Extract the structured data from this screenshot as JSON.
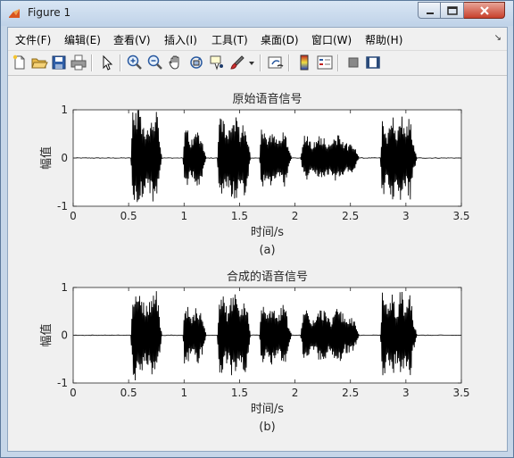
{
  "window": {
    "title": "Figure 1"
  },
  "menubar": {
    "items": [
      {
        "label": "文件(F)"
      },
      {
        "label": "编辑(E)"
      },
      {
        "label": "查看(V)"
      },
      {
        "label": "插入(I)"
      },
      {
        "label": "工具(T)"
      },
      {
        "label": "桌面(D)"
      },
      {
        "label": "窗口(W)"
      },
      {
        "label": "帮助(H)"
      }
    ],
    "overflow_icon": "dock-arrow-icon"
  },
  "toolbar": {
    "buttons": [
      "new-figure-icon",
      "open-file-icon",
      "save-icon",
      "print-icon",
      "pointer-icon",
      "zoom-in-icon",
      "zoom-out-icon",
      "pan-hand-icon",
      "rotate-3d-icon",
      "data-cursor-icon",
      "brush-icon",
      "brush-dropdown-icon",
      "link-plot-icon",
      "colorbar-icon",
      "legend-icon",
      "hide-plot-tools-icon",
      "show-plot-tools-icon"
    ]
  },
  "colors": {
    "waveform": "#000000",
    "axes_bg": "#ffffff",
    "figure_bg": "#f0f0f0"
  },
  "chart_data": [
    {
      "type": "line",
      "title": "原始语音信号",
      "xlabel": "时间/s",
      "ylabel": "幅值",
      "caption": "(a)",
      "xlim": [
        0,
        3.5
      ],
      "ylim": [
        -1,
        1
      ],
      "xticks": [
        "0",
        "0.5",
        "1",
        "1.5",
        "2",
        "2.5",
        "3",
        "3.5"
      ],
      "yticks": [
        "-1",
        "0",
        "1"
      ],
      "segments": [
        {
          "x": [
            0.52,
            0.8
          ],
          "amplitude": 1.0
        },
        {
          "x": [
            0.99,
            1.2
          ],
          "amplitude": 0.58
        },
        {
          "x": [
            1.3,
            1.6
          ],
          "amplitude": 0.88
        },
        {
          "x": [
            1.68,
            1.97
          ],
          "amplitude": 0.62
        },
        {
          "x": [
            2.05,
            2.58
          ],
          "amplitude": 0.48
        },
        {
          "x": [
            2.77,
            3.1
          ],
          "amplitude": 0.88
        }
      ]
    },
    {
      "type": "line",
      "title": "合成的语音信号",
      "xlabel": "时间/s",
      "ylabel": "幅值",
      "caption": "(b)",
      "xlim": [
        0,
        3.5
      ],
      "ylim": [
        -1,
        1
      ],
      "xticks": [
        "0",
        "0.5",
        "1",
        "1.5",
        "2",
        "2.5",
        "3",
        "3.5"
      ],
      "yticks": [
        "-1",
        "0",
        "1"
      ],
      "segments": [
        {
          "x": [
            0.52,
            0.8
          ],
          "amplitude": 0.98
        },
        {
          "x": [
            0.99,
            1.2
          ],
          "amplitude": 0.6
        },
        {
          "x": [
            1.3,
            1.6
          ],
          "amplitude": 0.9
        },
        {
          "x": [
            1.68,
            1.97
          ],
          "amplitude": 0.65
        },
        {
          "x": [
            2.05,
            2.58
          ],
          "amplitude": 0.55
        },
        {
          "x": [
            2.77,
            3.1
          ],
          "amplitude": 0.92
        }
      ]
    }
  ]
}
